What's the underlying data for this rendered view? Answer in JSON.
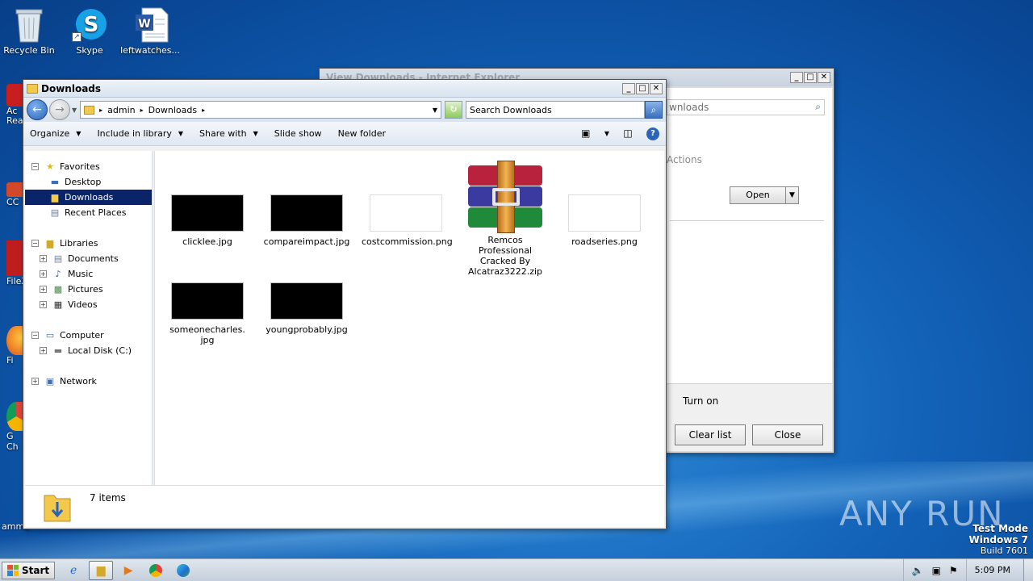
{
  "desktop": {
    "icons": [
      {
        "label": "Recycle Bin"
      },
      {
        "label": "Skype"
      },
      {
        "label": "leftwatches..."
      }
    ],
    "partial_icons": [
      {
        "label": "Ac\nRea"
      },
      {
        "label": "CC"
      },
      {
        "label": "FileZ"
      },
      {
        "label": "Fi"
      },
      {
        "label": "G\nCh"
      }
    ],
    "partial_text": "amme"
  },
  "ie_window": {
    "title": "View Downloads - Internet Explorer",
    "search_placeholder": "wnloads",
    "actions_label": "Actions",
    "open_button": "Open",
    "turn_on_label": "Turn on",
    "clear_list_button": "Clear list",
    "close_button": "Close"
  },
  "explorer": {
    "title": "Downloads",
    "breadcrumb": [
      "admin",
      "Downloads"
    ],
    "search_placeholder": "Search Downloads",
    "toolbar": {
      "organize": "Organize",
      "include_in_library": "Include in library",
      "share_with": "Share with",
      "slide_show": "Slide show",
      "new_folder": "New folder"
    },
    "nav": {
      "favorites": "Favorites",
      "desktop": "Desktop",
      "downloads": "Downloads",
      "recent_places": "Recent Places",
      "libraries": "Libraries",
      "documents": "Documents",
      "music": "Music",
      "pictures": "Pictures",
      "videos": "Videos",
      "computer": "Computer",
      "local_disk": "Local Disk (C:)",
      "network": "Network"
    },
    "files": [
      {
        "name": "clicklee.jpg"
      },
      {
        "name": "compareimpact.jpg"
      },
      {
        "name": "costcommission.png"
      },
      {
        "name": "Remcos Professional Cracked By Alcatraz3222.zip"
      },
      {
        "name": "roadseries.png"
      },
      {
        "name": "someonecharles.jpg"
      },
      {
        "name": "youngprobably.jpg"
      }
    ],
    "status": "7 items"
  },
  "taskbar": {
    "start_label": "Start",
    "clock": "5:09 PM"
  },
  "watermark": {
    "test_mode": "Test Mode",
    "windows": "Windows 7",
    "build": "Build 7601",
    "brand": "ANY RUN"
  },
  "colors": {
    "selection": "#0a246a",
    "desktop_blue": "#1262b8"
  }
}
